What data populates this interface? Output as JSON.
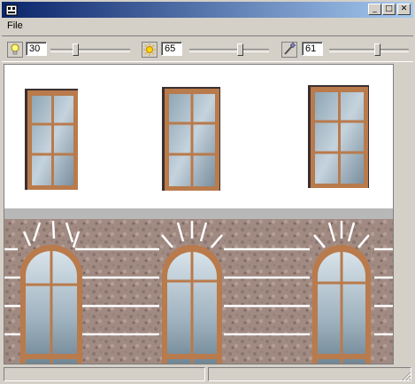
{
  "menu": {
    "file_label": "File"
  },
  "toolbar": {
    "control1": {
      "icon": "lightbulb-icon",
      "value": "30",
      "slider_fraction": 0.3
    },
    "control2": {
      "icon": "sun-icon",
      "value": "65",
      "slider_fraction": 0.65
    },
    "control3": {
      "icon": "brush-icon",
      "value": "61",
      "slider_fraction": 0.61
    }
  },
  "titlebar": {
    "minimize_glyph": "_",
    "maximize_glyph": "□",
    "close_glyph": "✕"
  },
  "colors": {
    "title_gradient_start": "#0a246a",
    "title_gradient_end": "#a6caf0",
    "window_frame": "#b97a4c",
    "upper_wall": "#ffffff",
    "lower_wall": "#a08a82"
  }
}
